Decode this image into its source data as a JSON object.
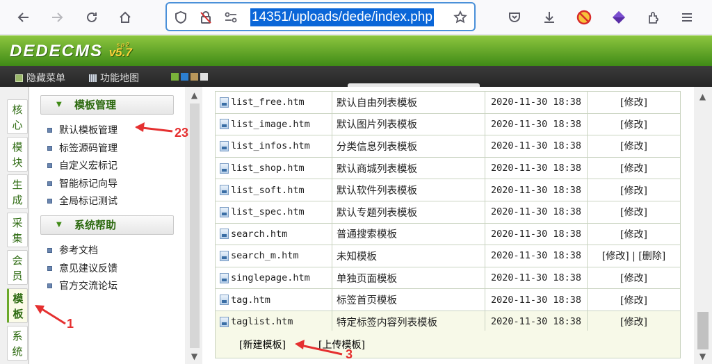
{
  "browser": {
    "url_text": "14351/uploads/dede/index.php",
    "icons": [
      "back-icon",
      "forward-icon",
      "reload-icon",
      "home-icon",
      "shield-icon",
      "lock-slash-icon",
      "permissions-icon",
      "bookmark-star-icon",
      "pocket-icon",
      "download-icon",
      "blocked-extension-icon",
      "extension-gem-icon",
      "extensions-icon",
      "menu-icon"
    ]
  },
  "header": {
    "logo_text": "DEDECMS",
    "logo_version": "v5.7",
    "logo_super": "sp2"
  },
  "topbar": {
    "hide_menu": "隐藏菜单",
    "function_map": "功能地图",
    "skin_colors": [
      "#7ab23a",
      "#2c7fd0",
      "#b8965a",
      "#e0e0e0"
    ]
  },
  "left_tabs": [
    {
      "label": "核心"
    },
    {
      "label": "模块"
    },
    {
      "label": "生成"
    },
    {
      "label": "采集"
    },
    {
      "label": "会员"
    },
    {
      "label": "模板"
    },
    {
      "label": "系统"
    }
  ],
  "menu": {
    "section1_title": "模板管理",
    "section1_items": [
      "默认模板管理",
      "标签源码管理",
      "自定义宏标记",
      "智能标记向导",
      "全局标记测试"
    ],
    "section2_title": "系统帮助",
    "section2_items": [
      "参考文档",
      "意见建议反馈",
      "官方交流论坛"
    ]
  },
  "table": {
    "rows": [
      {
        "file": "list_free.htm",
        "desc": "默认自由列表模板",
        "date": "2020-11-30 18:38",
        "ops": "[修改]"
      },
      {
        "file": "list_image.htm",
        "desc": "默认图片列表模板",
        "date": "2020-11-30 18:38",
        "ops": "[修改]"
      },
      {
        "file": "list_infos.htm",
        "desc": "分类信息列表模板",
        "date": "2020-11-30 18:38",
        "ops": "[修改]"
      },
      {
        "file": "list_shop.htm",
        "desc": "默认商城列表模板",
        "date": "2020-11-30 18:38",
        "ops": "[修改]"
      },
      {
        "file": "list_soft.htm",
        "desc": "默认软件列表模板",
        "date": "2020-11-30 18:38",
        "ops": "[修改]"
      },
      {
        "file": "list_spec.htm",
        "desc": "默认专题列表模板",
        "date": "2020-11-30 18:38",
        "ops": "[修改]"
      },
      {
        "file": "search.htm",
        "desc": "普通搜索模板",
        "date": "2020-11-30 18:38",
        "ops": "[修改]"
      },
      {
        "file": "search_m.htm",
        "desc": "未知模板",
        "date": "2020-11-30 18:38",
        "ops": "[修改] | [删除]"
      },
      {
        "file": "singlepage.htm",
        "desc": "单独页面模板",
        "date": "2020-11-30 18:38",
        "ops": "[修改]"
      },
      {
        "file": "tag.htm",
        "desc": "标签首页模板",
        "date": "2020-11-30 18:38",
        "ops": "[修改]"
      },
      {
        "file": "taglist.htm",
        "desc": "特定标签内容列表模板",
        "date": "2020-11-30 18:38",
        "ops": "[修改]"
      }
    ],
    "new_template": "[新建模板]",
    "upload_template": "[上传模板]"
  },
  "annotations": {
    "a1": "1",
    "a23": "23",
    "a3": "3",
    "color": "#e53030"
  }
}
